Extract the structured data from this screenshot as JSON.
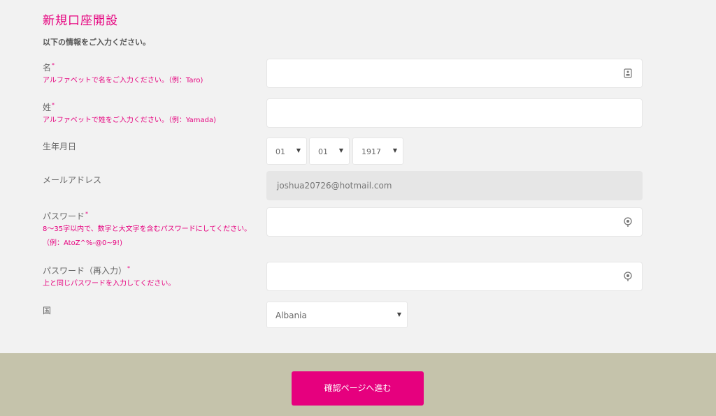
{
  "form": {
    "title": "新規口座開設",
    "intro": "以下の情報をご入力ください。",
    "first_name": {
      "label": "名",
      "hint": "アルファベットで名をご入力ください。（例：Taro)",
      "value": ""
    },
    "last_name": {
      "label": "姓",
      "hint": "アルファベットで姓をご入力ください。（例：Yamada)",
      "value": ""
    },
    "birthdate": {
      "label": "生年月日",
      "month": "01",
      "day": "01",
      "year": "1917"
    },
    "email": {
      "label": "メールアドレス",
      "value": "joshua20726@hotmail.com"
    },
    "password": {
      "label": "パスワード",
      "hint": "8～35字以内で、数字と大文字を含むパスワードにしてください。（例：AtoZ^%-@0~9!)",
      "value": ""
    },
    "password_confirm": {
      "label": "パスワード（再入力）",
      "hint": "上と同じパスワードを入力してください。",
      "value": ""
    },
    "country": {
      "label": "国",
      "value": "Albania"
    },
    "required_mark": "*"
  },
  "footer": {
    "submit_label": "確認ページへ進む"
  },
  "colors": {
    "accent": "#e6007e",
    "footer_bg": "#c5c3ab",
    "page_bg": "#f2f2f2"
  }
}
